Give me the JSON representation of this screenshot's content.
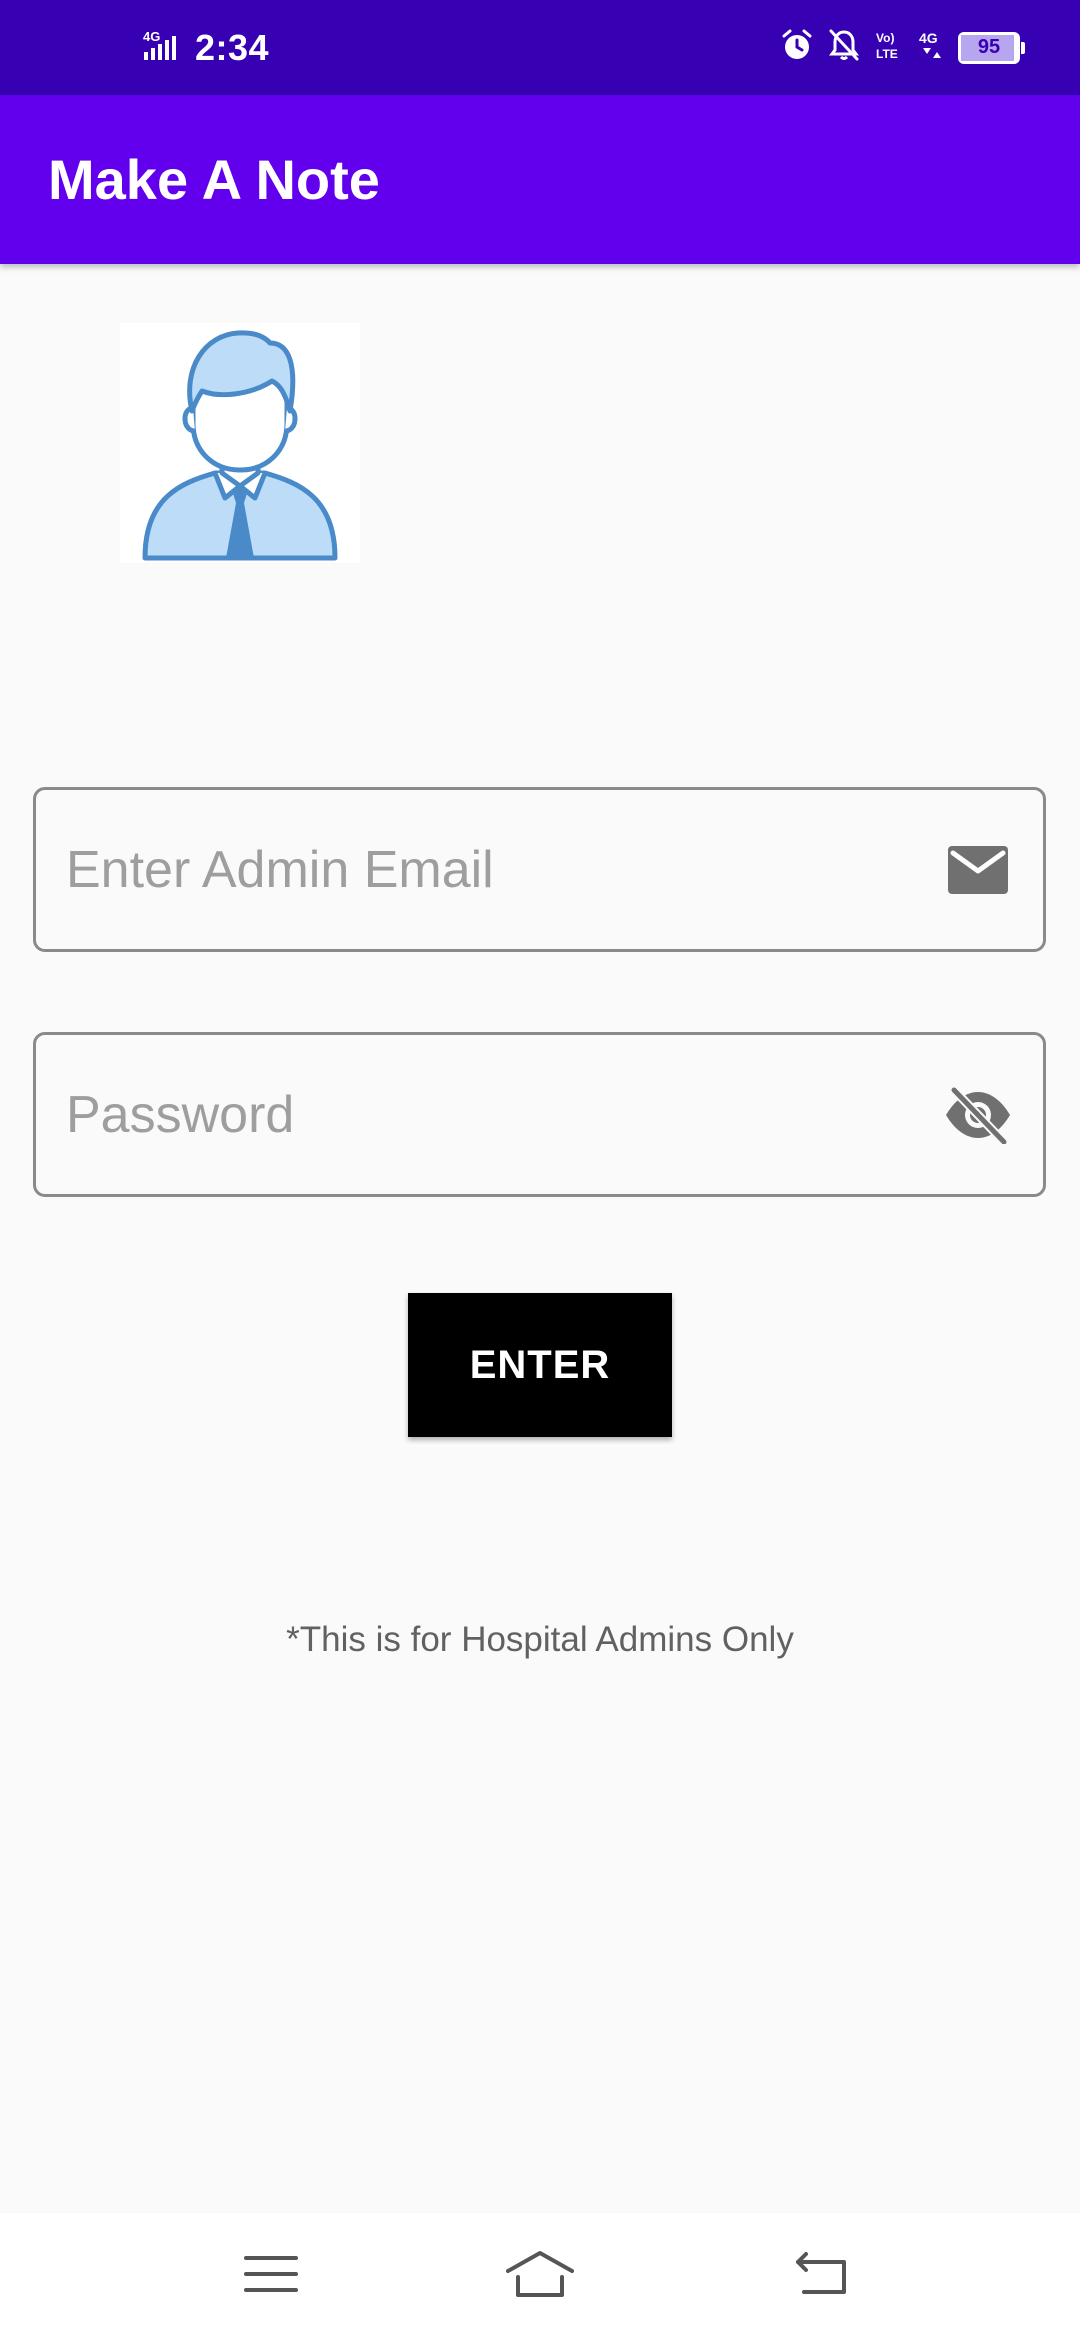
{
  "status_bar": {
    "network": "4G",
    "time": "2:34",
    "icons": [
      "alarm-icon",
      "notifications-off-icon",
      "volte-icon",
      "4g-icon"
    ],
    "battery_level": "95",
    "volte_label": "Vo LTE",
    "net_label": "4G"
  },
  "app_bar": {
    "title": "Make A Note"
  },
  "avatar": {
    "icon": "admin-avatar-icon"
  },
  "form": {
    "email_placeholder": "Enter Admin Email",
    "email_value": "",
    "email_icon": "email-icon",
    "password_placeholder": "Password",
    "password_value": "",
    "password_icon": "visibility-off-icon",
    "submit_label": "ENTER"
  },
  "note": "*This is for Hospital Admins Only",
  "nav_bar": {
    "items": [
      "menu-icon",
      "home-icon",
      "back-icon"
    ]
  },
  "colors": {
    "status_bar": "#3700b3",
    "app_bar": "#6200ee",
    "button": "#000000",
    "avatar_blue": "#4a8ac8",
    "avatar_fill": "#bcdcf8"
  }
}
